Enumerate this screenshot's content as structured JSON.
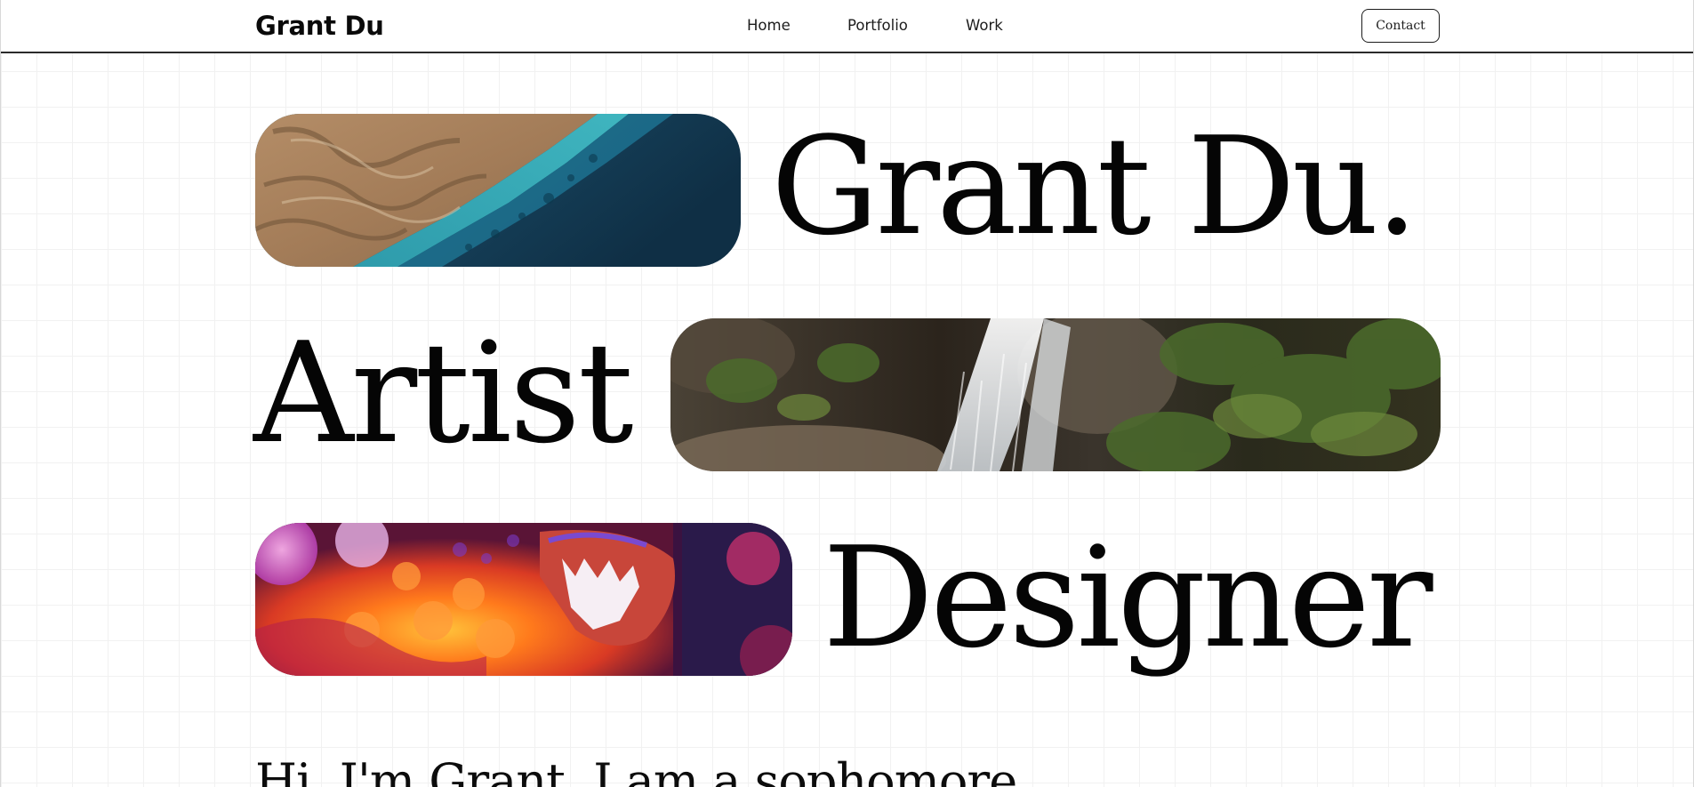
{
  "header": {
    "brand": "Grant Du",
    "nav": [
      {
        "label": "Home"
      },
      {
        "label": "Portfolio"
      },
      {
        "label": "Work"
      }
    ],
    "contact_label": "Contact"
  },
  "hero": {
    "line1": "Grant Du.",
    "line2": "Artist",
    "line3": "Designer",
    "images": [
      {
        "name": "coastline-aerial-photo",
        "colors": [
          "#b08a62",
          "#2aa5b6",
          "#123a52"
        ]
      },
      {
        "name": "waterfall-photo",
        "colors": [
          "#3a3226",
          "#e9ecee",
          "#445a2a"
        ]
      },
      {
        "name": "dragon-lantern-photo",
        "colors": [
          "#e2462a",
          "#ff9a1e",
          "#d96ad6"
        ]
      }
    ]
  },
  "intro": {
    "text": "Hi, I'm Grant. I am a sophomore"
  },
  "colors": {
    "text": "#050505",
    "background": "#ffffff",
    "grid": "#f1f1f1"
  }
}
